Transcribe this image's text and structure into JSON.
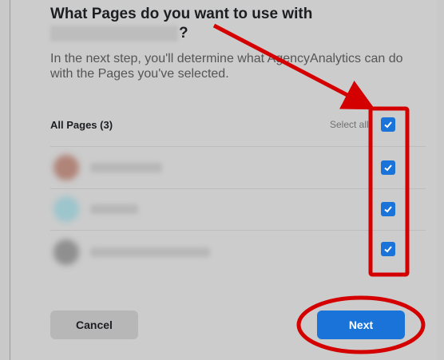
{
  "dialog": {
    "title": "What Pages do you want to use with",
    "title_suffix": "?",
    "subtitle": "In the next step, you'll determine what AgencyAnalytics can do with the Pages you've selected."
  },
  "pages": {
    "header_label": "All Pages (3)",
    "select_all_label": "Select all",
    "select_all_checked": true,
    "items": [
      {
        "checked": true,
        "avatar_color": "#b08478"
      },
      {
        "checked": true,
        "avatar_color": "#9cc5cc"
      },
      {
        "checked": true,
        "avatar_color": "#8f8f8f"
      }
    ]
  },
  "buttons": {
    "cancel_label": "Cancel",
    "next_label": "Next"
  },
  "colors": {
    "accent": "#1a73d9",
    "annotation": "#d40000"
  },
  "icons": {
    "checkbox": "checkmark-icon"
  }
}
